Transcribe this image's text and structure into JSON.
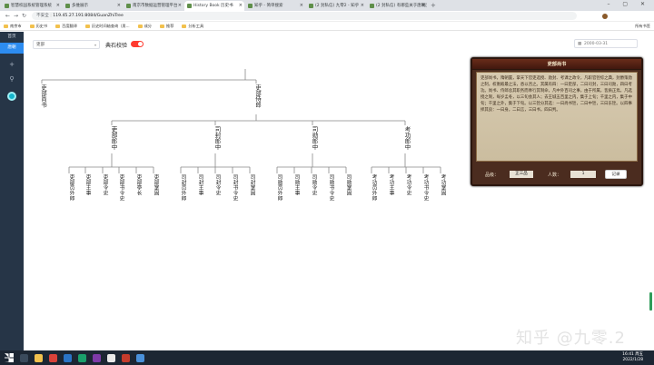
{
  "browser": {
    "tabs": [
      {
        "title": "智慧校园系统管理系统",
        "active": false
      },
      {
        "title": "多维展示",
        "active": false
      },
      {
        "title": "南京市数据运营管理平台",
        "active": false
      },
      {
        "title": "History Book 历史书",
        "active": true
      },
      {
        "title": "知乎 - 简单搜索",
        "active": false
      },
      {
        "title": "(2 封私信) 九零2 - 知乎",
        "active": false
      },
      {
        "title": "(2 封私信) 有哪些关于唐朝历史...",
        "active": false
      }
    ],
    "address": {
      "warning": "不安全",
      "url": "119.45.27.191:8084/GuanZhiTree"
    },
    "bookmarks": [
      "南京市",
      "历史书",
      "百度翻译",
      "历史时间轴查询（男...",
      "成分",
      "推荐",
      "分析工具"
    ],
    "bookmarks_right": "所有书签"
  },
  "sidebar": {
    "items": [
      "首页",
      "唐朝"
    ]
  },
  "controls": {
    "dynasty_select": "吏部",
    "verify_label": "典石校验",
    "date_value": "2000-03-31"
  },
  "tree": {
    "root": "",
    "l1": [
      "吏部尚书",
      "吏部侍郎"
    ],
    "l2": [
      "吏部郎中",
      "司封郎中",
      "司勋郎中",
      "考功郎中"
    ],
    "l3": [
      [
        "吏部员外郎",
        "吏部主事",
        "吏部令史",
        "吏部书令史",
        "吏部亭长",
        "吏部掌固"
      ],
      [
        "司封员外郎",
        "司封主事",
        "司封令史",
        "司封书令史",
        "司封掌固"
      ],
      [
        "司勋员外郎",
        "司勋主事",
        "司勋令史",
        "司勋书令史",
        "司勋掌固"
      ],
      [
        "考功员外郎",
        "考功主事",
        "考功令史",
        "考功书令史",
        "考功掌固"
      ]
    ]
  },
  "panel": {
    "title": "吏部尚书",
    "description": "吏部尚书，隋朝置，掌天下官吏选授、勋封、考课之政令，凡职官铨综之典，封爵策勋之制，权衡殿最之法，悉以咨之。其属有四：一曰吏部，二曰司封，三曰司勋，四曰考功。尚书、侍郎总其职务而奉行其制命，凡中外百司之事，由于所属，皆质正焉。凡选授之制，每岁孟冬，以三旬会其人；去王城五百里之内，集于上旬；千里之内，集于中旬；千里之外，集于下旬。以三铨分其选：一曰尚书铨，二曰中铨，三曰东铨。以四事择其良：一曰身，二曰言，三曰书，四曰判。",
    "rank_label": "品级：",
    "rank_value": "正三品",
    "count_label": "人数：",
    "count_value": "1",
    "confirm": "记录"
  },
  "watermark": "知乎 @九零.2",
  "taskbar": {
    "time": "16:41 周五",
    "date": "2022/1/28"
  }
}
